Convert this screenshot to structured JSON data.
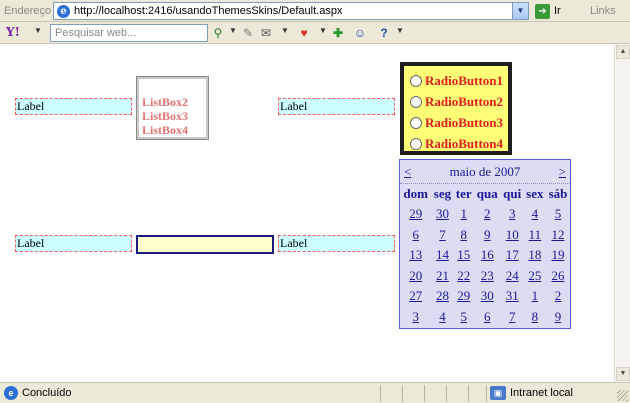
{
  "browser": {
    "address_label": "Endereço",
    "url": "http://localhost:2416/usandoThemesSkins/Default.aspx",
    "go_label": "Ir",
    "links_label": "Links",
    "search_placeholder": "Pesquisar web..."
  },
  "page": {
    "labels": [
      "Label",
      "Label",
      "Label",
      "Label"
    ],
    "listbox": {
      "items": [
        "ListBox2",
        "ListBox3",
        "ListBox4"
      ]
    },
    "textbox": {
      "value": ""
    },
    "radio_list": {
      "items": [
        "RadioButton1",
        "RadioButton2",
        "RadioButton3",
        "RadioButton4"
      ]
    },
    "calendar": {
      "prev": "<",
      "title": "maio de 2007",
      "next": ">",
      "weekdays": [
        "dom",
        "seg",
        "ter",
        "qua",
        "qui",
        "sex",
        "sáb"
      ],
      "weeks": [
        [
          "29",
          "30",
          "1",
          "2",
          "3",
          "4",
          "5"
        ],
        [
          "6",
          "7",
          "8",
          "9",
          "10",
          "11",
          "12"
        ],
        [
          "13",
          "14",
          "15",
          "16",
          "17",
          "18",
          "19"
        ],
        [
          "20",
          "21",
          "22",
          "23",
          "24",
          "25",
          "26"
        ],
        [
          "27",
          "28",
          "29",
          "30",
          "31",
          "1",
          "2"
        ],
        [
          "3",
          "4",
          "5",
          "6",
          "7",
          "8",
          "9"
        ]
      ]
    }
  },
  "status": {
    "text": "Concluído",
    "zone": "Intranet local"
  },
  "colors": {
    "label_bg": "#ccffff",
    "label_border": "#ff5a5a",
    "radio_bg": "#ffff77",
    "radio_text": "#dd1f1f",
    "calendar_bg": "#dcdcf2",
    "calendar_text": "#1a1a9a",
    "textbox_bg": "#ffffcc"
  }
}
